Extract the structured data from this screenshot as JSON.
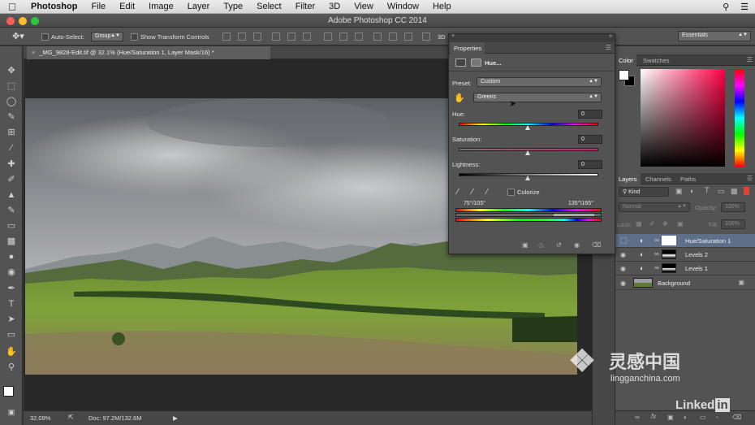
{
  "menubar": {
    "app": "Photoshop",
    "items": [
      "File",
      "Edit",
      "Image",
      "Layer",
      "Type",
      "Select",
      "Filter",
      "3D",
      "View",
      "Window",
      "Help"
    ]
  },
  "window": {
    "title": "Adobe Photoshop CC 2014"
  },
  "options": {
    "auto_select": "Auto-Select:",
    "group": "Group",
    "show_transform": "Show Transform Controls",
    "mode_3d": "3D",
    "workspace": "Essentials"
  },
  "document": {
    "tab_title": "_MG_9828-Edit.tif @ 32.1% (Hue/Saturation 1, Layer Mask/16) *",
    "zoom": "32.09%",
    "doc_size": "Doc: 97.2M/132.6M"
  },
  "properties": {
    "panel_title": "Properties",
    "adjustment": "Hue...",
    "preset_label": "Preset:",
    "preset_value": "Custom",
    "channel_value": "Greens",
    "hue_label": "Hue:",
    "hue_value": "0",
    "saturation_label": "Saturation:",
    "saturation_value": "0",
    "lightness_label": "Lightness:",
    "lightness_value": "0",
    "colorize_label": "Colorize",
    "range_left": "75°/105°",
    "range_right": "135°\\165°"
  },
  "color_panel": {
    "tabs": [
      "Color",
      "Swatches"
    ]
  },
  "layers_panel": {
    "tabs": [
      "Layers",
      "Channels",
      "Paths"
    ],
    "filter": "Kind",
    "blend_mode": "Normal",
    "opacity_label": "Opacity:",
    "opacity_value": "100%",
    "lock_label": "Lock:",
    "fill_label": "Fill:",
    "fill_value": "100%",
    "layers": [
      {
        "name": "Hue/Saturation 1"
      },
      {
        "name": "Levels 2"
      },
      {
        "name": "Levels 1"
      },
      {
        "name": "Background"
      }
    ]
  },
  "watermark": {
    "site": "lingganchina.com",
    "cn": "灵感中国",
    "brand": "Linked",
    "brand2": "in"
  },
  "colors": {
    "selection": "#5e6f8c",
    "panel": "#535353",
    "canvas_bg": "#282828"
  }
}
